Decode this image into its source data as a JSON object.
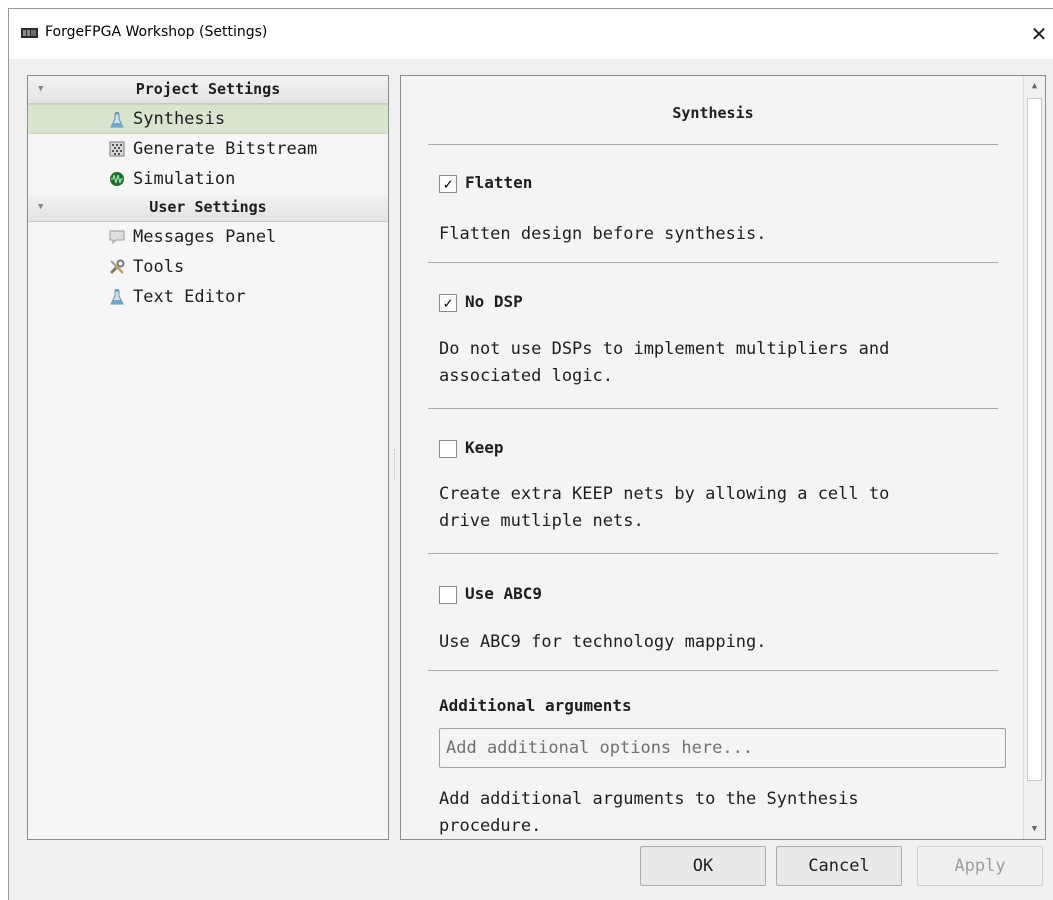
{
  "window": {
    "title": "ForgeFPGA Workshop (Settings)",
    "close_glyph": "✕"
  },
  "tree": {
    "groups": [
      {
        "label": "Project Settings",
        "items": [
          {
            "label": "Synthesis",
            "icon": "flask-icon",
            "selected": true
          },
          {
            "label": "Generate Bitstream",
            "icon": "bitstream-icon",
            "selected": false
          },
          {
            "label": "Simulation",
            "icon": "simulation-icon",
            "selected": false
          }
        ]
      },
      {
        "label": "User Settings",
        "items": [
          {
            "label": "Messages Panel",
            "icon": "message-icon",
            "selected": false
          },
          {
            "label": "Tools",
            "icon": "tools-icon",
            "selected": false
          },
          {
            "label": "Text Editor",
            "icon": "flask-icon",
            "selected": false
          }
        ]
      }
    ]
  },
  "pane": {
    "title": "Synthesis",
    "options": [
      {
        "label": "Flatten",
        "checked": true,
        "description": "Flatten design before synthesis."
      },
      {
        "label": "No DSP",
        "checked": true,
        "description_lines": [
          "Do not use DSPs to implement multipliers and",
          "associated logic."
        ]
      },
      {
        "label": "Keep",
        "checked": false,
        "description_lines": [
          "Create extra KEEP nets by allowing a cell to",
          "drive mutliple nets."
        ]
      },
      {
        "label": "Use ABC9",
        "checked": false,
        "description": "Use ABC9 for technology mapping."
      }
    ],
    "additional": {
      "label": "Additional arguments",
      "placeholder": "Add additional options here...",
      "value": "",
      "description_lines": [
        "Add additional arguments to the Synthesis",
        "procedure."
      ]
    }
  },
  "buttons": {
    "ok": "OK",
    "cancel": "Cancel",
    "apply": "Apply"
  },
  "colors": {
    "selected_row": "#d9e4cf",
    "window_bg": "#f0f0f0"
  }
}
